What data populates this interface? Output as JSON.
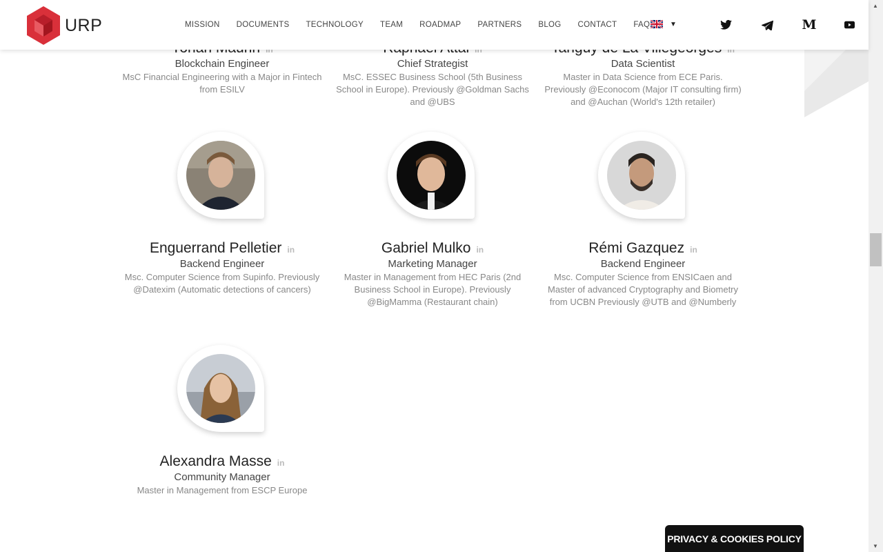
{
  "brand": {
    "name": "URP",
    "color": "#d9303a"
  },
  "nav": [
    {
      "label": "MISSION"
    },
    {
      "label": "DOCUMENTS"
    },
    {
      "label": "TECHNOLOGY"
    },
    {
      "label": "TEAM"
    },
    {
      "label": "ROADMAP"
    },
    {
      "label": "PARTNERS"
    },
    {
      "label": "BLOG"
    },
    {
      "label": "CONTACT"
    },
    {
      "label": "FAQ"
    }
  ],
  "language": {
    "icon": "uk-flag-icon",
    "dropdown_icon": "caret-down-icon"
  },
  "social": [
    {
      "icon": "twitter-icon"
    },
    {
      "icon": "telegram-icon"
    },
    {
      "icon": "medium-icon",
      "glyph": "M"
    },
    {
      "icon": "youtube-icon"
    }
  ],
  "team_top": [
    {
      "name": "Yohan Maurin",
      "role": "Blockchain Engineer",
      "desc": "MsC Financial Engineering with a Major in Fintech from ESILV"
    },
    {
      "name": "Raphaël Attal",
      "role": "Chief Strategist",
      "desc": "MsC. ESSEC Business School (5th Business School in Europe). Previously @Goldman Sachs and @UBS"
    },
    {
      "name": "Tanguy de La Villegeorges",
      "role": "Data Scientist",
      "desc": "Master in Data Science from ECE Paris. Previously @Econocom (Major IT consulting firm) and @Auchan (World's 12th retailer)"
    }
  ],
  "team": [
    {
      "name": "Enguerrand Pelletier",
      "role": "Backend Engineer",
      "desc": "Msc. Computer Science from Supinfo. Previously @Datexim (Automatic detections of cancers)"
    },
    {
      "name": "Gabriel Mulko",
      "role": "Marketing Manager",
      "desc": "Master in Management from HEC Paris (2nd Business School in Europe). Previously @BigMamma (Restaurant chain)"
    },
    {
      "name": "Rémi Gazquez",
      "role": "Backend Engineer",
      "desc": "Msc. Computer Science from ENSICaen and Master of advanced Cryptography and Biometry from UCBN Previously @UTB and @Numberly"
    },
    {
      "name": "Alexandra Masse",
      "role": "Community Manager",
      "desc": "Master in Management from ESCP Europe"
    }
  ],
  "linkedin_label": "in",
  "privacy_label": "PRIVACY & COOKIES POLICY"
}
